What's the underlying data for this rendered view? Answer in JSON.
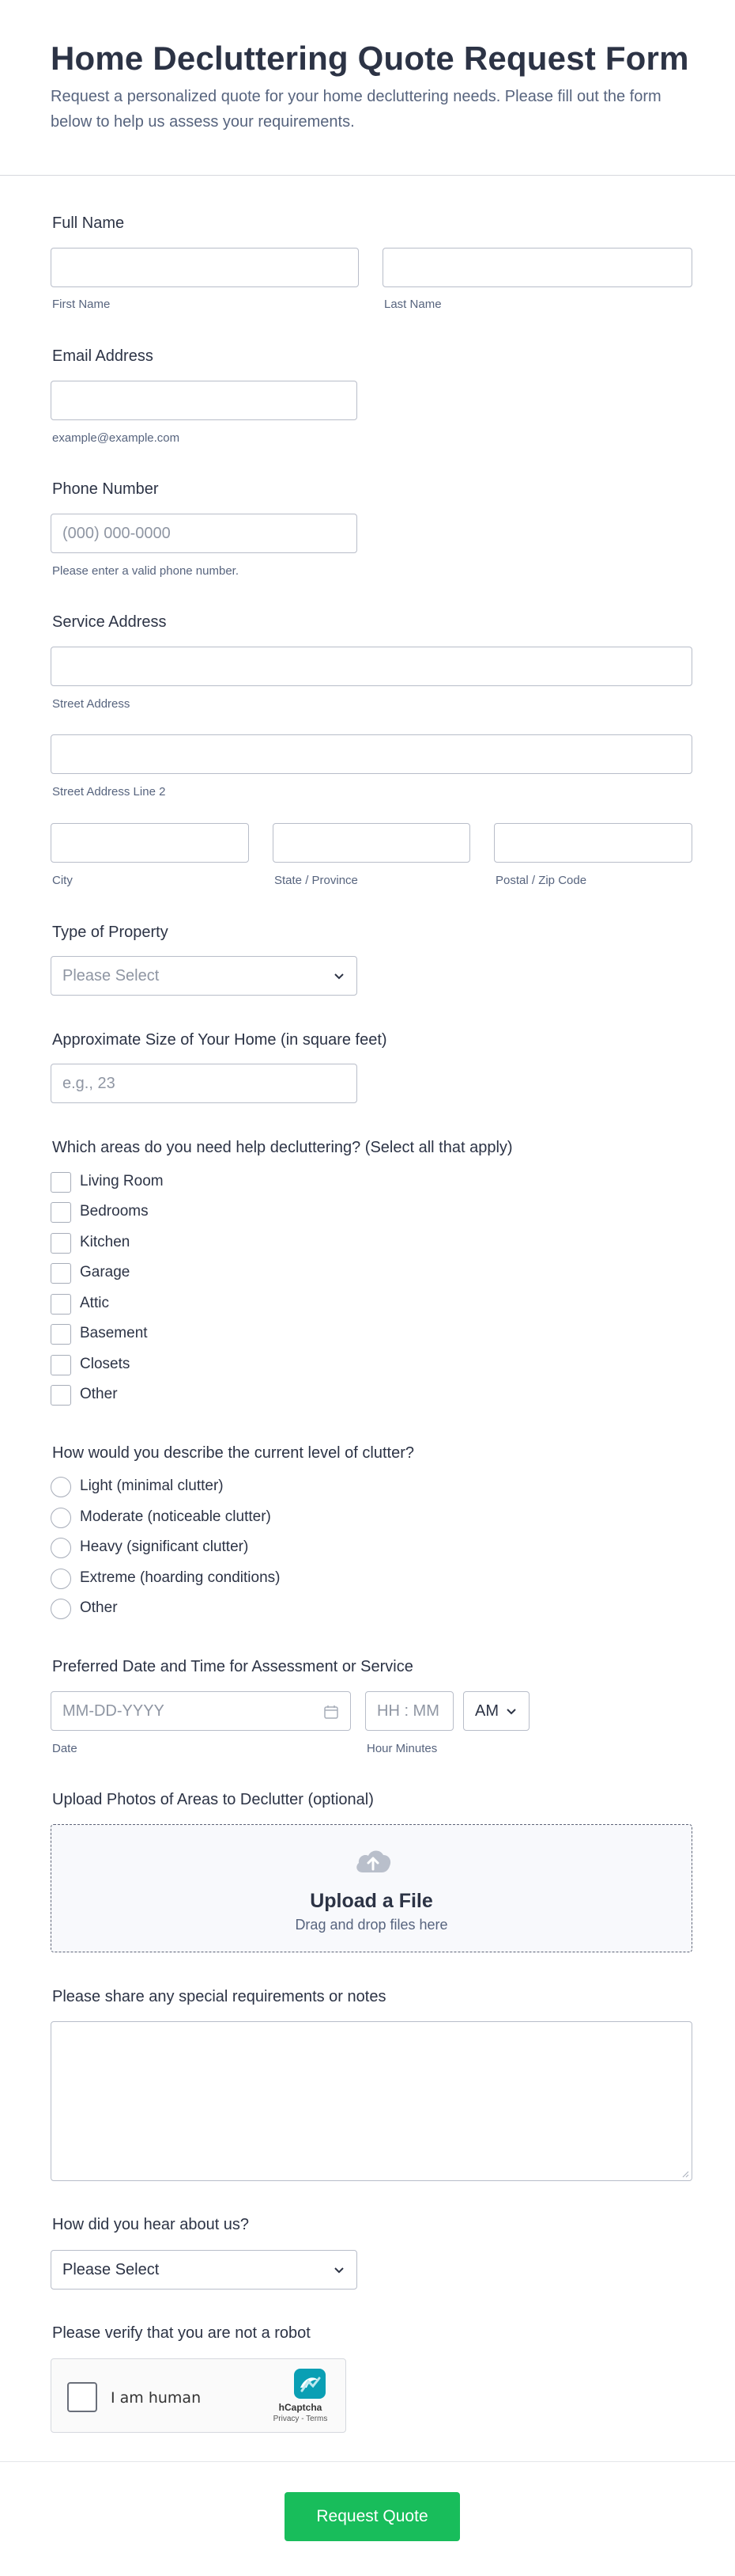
{
  "header": {
    "title": "Home Decluttering Quote Request Form",
    "description": "Request a personalized quote for your home decluttering needs. Please fill out the form below to help us assess your requirements."
  },
  "full_name": {
    "label": "Full Name",
    "first_sub": "First Name",
    "last_sub": "Last Name"
  },
  "email": {
    "label": "Email Address",
    "sub": "example@example.com"
  },
  "phone": {
    "label": "Phone Number",
    "placeholder": "(000) 000-0000",
    "sub": "Please enter a valid phone number."
  },
  "address": {
    "label": "Service Address",
    "street_sub": "Street Address",
    "street2_sub": "Street Address Line 2",
    "city_sub": "City",
    "state_sub": "State / Province",
    "zip_sub": "Postal / Zip Code"
  },
  "property_type": {
    "label": "Type of Property",
    "placeholder": "Please Select"
  },
  "home_size": {
    "label": "Approximate Size of Your Home (in square feet)",
    "placeholder": "e.g., 23"
  },
  "areas": {
    "label": "Which areas do you need help decluttering? (Select all that apply)",
    "options": [
      "Living Room",
      "Bedrooms",
      "Kitchen",
      "Garage",
      "Attic",
      "Basement",
      "Closets",
      "Other"
    ]
  },
  "clutter_level": {
    "label": "How would you describe the current level of clutter?",
    "options": [
      "Light (minimal clutter)",
      "Moderate (noticeable clutter)",
      "Heavy (significant clutter)",
      "Extreme (hoarding conditions)",
      "Other"
    ]
  },
  "datetime": {
    "label": "Preferred Date and Time for Assessment or Service",
    "date_placeholder": "MM-DD-YYYY",
    "time_placeholder": "HH : MM",
    "ampm_value": "AM",
    "date_sub": "Date",
    "time_sub": "Hour Minutes"
  },
  "upload": {
    "label": "Upload Photos of Areas to Declutter (optional)",
    "title": "Upload a File",
    "hint": "Drag and drop files here"
  },
  "notes": {
    "label": "Please share any special requirements or notes"
  },
  "referral": {
    "label": "How did you hear about us?",
    "value": "Please Select"
  },
  "captcha": {
    "label": "Please verify that you are not a robot",
    "checkbox_text": "I am human",
    "brand": "hCaptcha",
    "terms": "Privacy - Terms"
  },
  "submit": {
    "label": "Request Quote",
    "color": "#18bd5b"
  },
  "colors": {
    "text": "#2c3345",
    "muted": "#57647e",
    "border": "#b8bdc9"
  }
}
